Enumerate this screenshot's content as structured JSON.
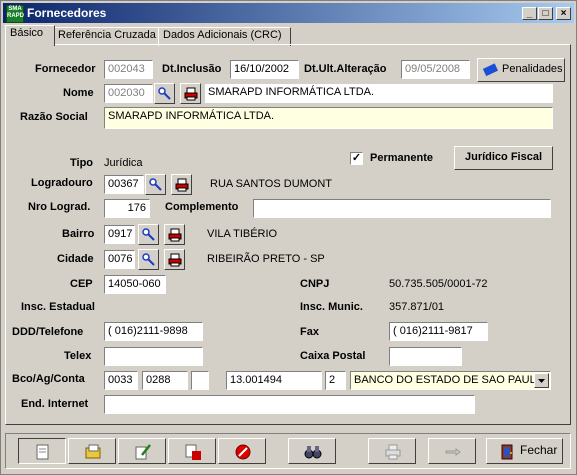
{
  "window": {
    "title": "Fornecedores",
    "icon_text": "SMA RAPD"
  },
  "tabs": [
    {
      "label": "Básico"
    },
    {
      "label": "Referência Cruzada"
    },
    {
      "label": "Dados Adicionais (CRC)"
    }
  ],
  "form": {
    "fornecedor": {
      "label": "Fornecedor",
      "value": "002043"
    },
    "dt_inclusao": {
      "label": "Dt.Inclusão",
      "value": "16/10/2002"
    },
    "dt_ult_alteracao": {
      "label": "Dt.Ult.Alteração",
      "value": "09/05/2008"
    },
    "penalidades_button": "Penalidades",
    "nome": {
      "label": "Nome",
      "code": "002030",
      "value": "SMARAPD INFORMÁTICA LTDA."
    },
    "razao_social": {
      "label": "Razão Social",
      "value": "SMARAPD INFORMÁTICA LTDA."
    },
    "tipo": {
      "label": "Tipo",
      "value": "Jurídica"
    },
    "permanente": {
      "label": "Permanente",
      "checked": true
    },
    "juridico_fiscal_button": "Jurídico Fiscal",
    "logradouro": {
      "label": "Logradouro",
      "code": "00367",
      "value": "RUA  SANTOS DUMONT"
    },
    "nro_lograd": {
      "label": "Nro Lograd.",
      "value": "176"
    },
    "complemento": {
      "label": "Complemento",
      "value": ""
    },
    "bairro": {
      "label": "Bairro",
      "code": "0917",
      "value": "VILA TIBÉRIO"
    },
    "cidade": {
      "label": "Cidade",
      "code": "0076",
      "value": "RIBEIRÃO PRETO - SP"
    },
    "cep": {
      "label": "CEP",
      "value": "14050-060"
    },
    "cnpj": {
      "label": "CNPJ",
      "value": "50.735.505/0001-72"
    },
    "insc_estadual": {
      "label": "Insc. Estadual",
      "value": ""
    },
    "insc_munic": {
      "label": "Insc. Munic.",
      "value": "357.871/01"
    },
    "ddd_telefone": {
      "label": "DDD/Telefone",
      "value": "( 016)2111-9898"
    },
    "fax": {
      "label": "Fax",
      "value": "( 016)2111-9817"
    },
    "telex": {
      "label": "Telex",
      "value": ""
    },
    "caixa_postal": {
      "label": "Caixa Postal",
      "value": ""
    },
    "bco_ag_conta": {
      "label": "Bco/Ag/Conta",
      "banco": "0033",
      "agencia": "0288",
      "agencia_dv": "",
      "conta": "13.001494",
      "conta_dv": "2",
      "banco_nome": "BANCO DO ESTADO DE SAO PAULO"
    },
    "end_internet": {
      "label": "End. Internet",
      "value": ""
    }
  },
  "toolbar": {
    "fechar_label": "Fechar"
  }
}
